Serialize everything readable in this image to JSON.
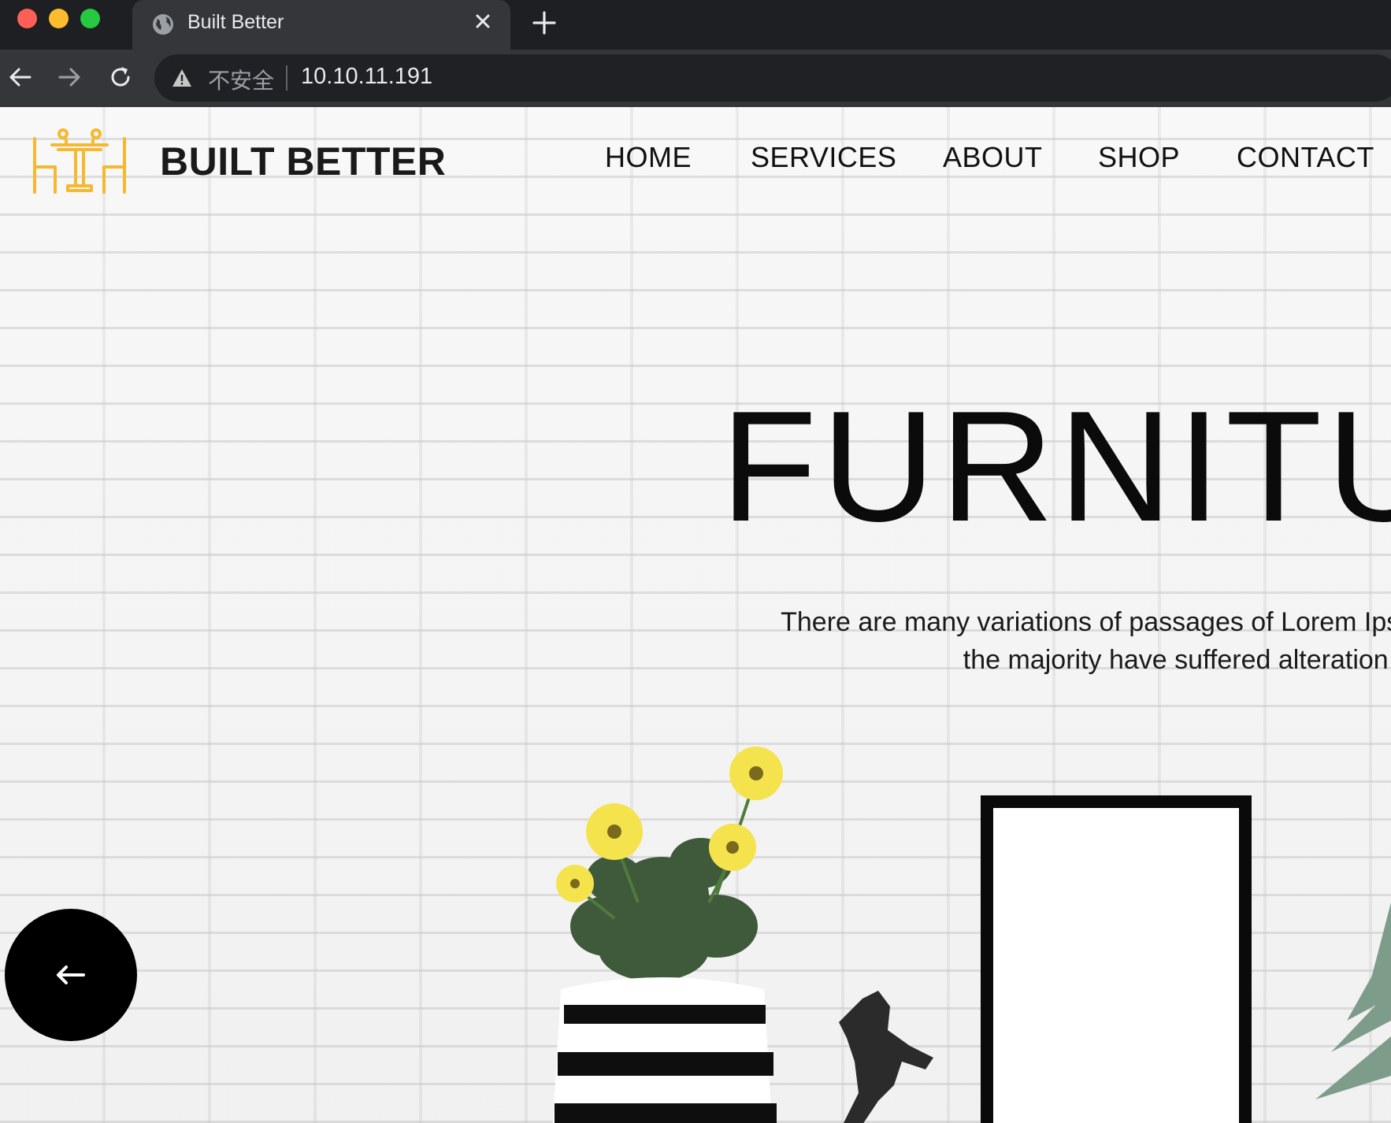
{
  "browser": {
    "tab_title": "Built Better",
    "security_label": "不安全",
    "url": "10.10.11.191"
  },
  "site": {
    "brand": "BUILT BETTER",
    "logo_color": "#f5b82e",
    "nav": [
      "HOME",
      "SERVICES",
      "ABOUT",
      "SHOP",
      "CONTACT"
    ]
  },
  "hero": {
    "title": "FURNITUR",
    "text_line1": "There are many variations of passages of Lorem Ipsum a",
    "text_line2": "the majority have suffered alteration in some"
  },
  "icons": {
    "globe": "globe-icon",
    "close": "close-icon",
    "new_tab": "plus-icon",
    "back": "arrow-left-icon",
    "forward": "arrow-right-icon",
    "reload": "reload-icon",
    "warning": "warning-icon",
    "scroll_back": "arrow-left-icon"
  }
}
